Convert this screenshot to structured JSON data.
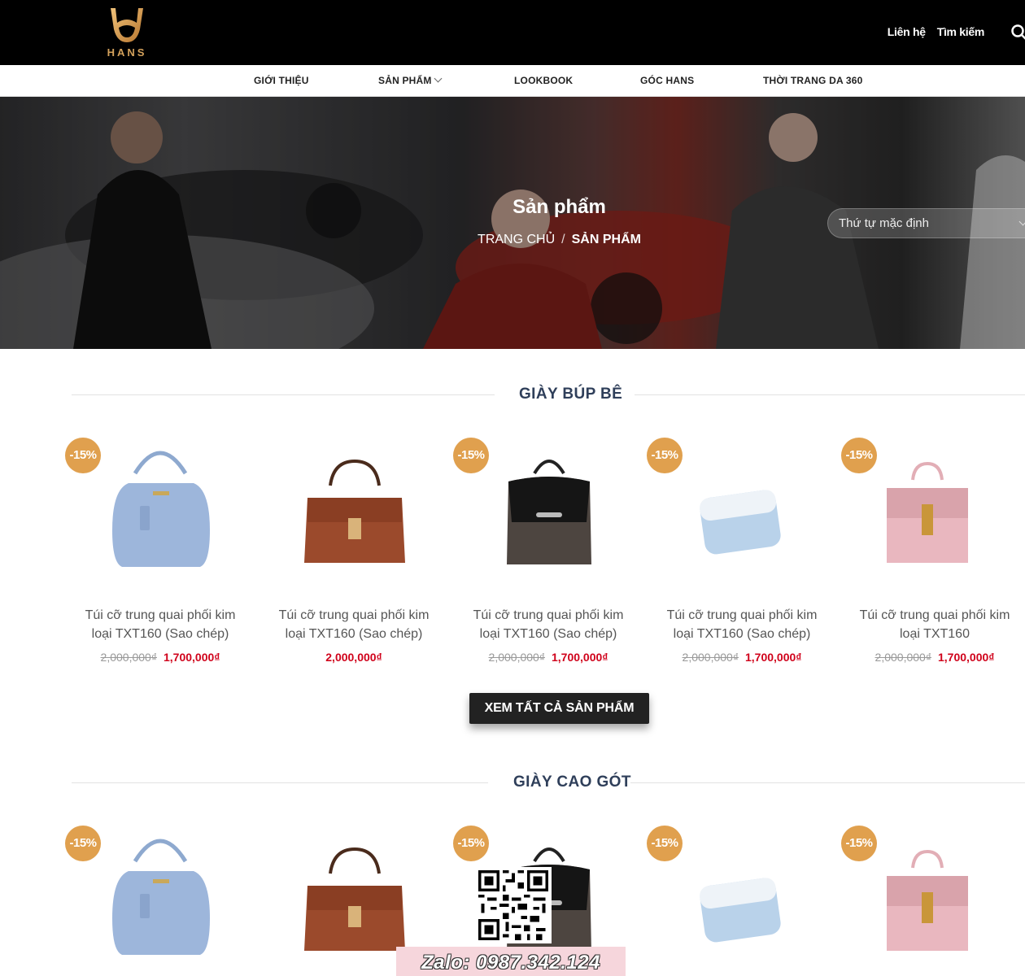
{
  "brand": {
    "logo_text": "HANS",
    "accent": "#d4a25c"
  },
  "topbar": {
    "links": [
      "Liên hệ",
      "Tìm kiếm"
    ],
    "search_icon": "search-icon"
  },
  "nav": {
    "items": [
      "GIỚI THIỆU",
      "SẢN PHẨM",
      "LOOKBOOK",
      "GÓC HANS",
      "THỜI TRANG DA 360"
    ]
  },
  "hero": {
    "title": "Sản phẩm",
    "breadcrumb": {
      "home": "TRANG CHỦ",
      "separator": "/",
      "current": "SẢN PHẨM"
    },
    "sort_select": {
      "value": "Thứ tự mặc định"
    }
  },
  "sections": [
    {
      "title": "GIÀY BÚP BÊ",
      "products": [
        {
          "name_1": "Túi cỡ trung quai phối kim",
          "name_2": "loại TXT160 (Sao chép)",
          "badge": "-15%",
          "old_price": "2,000,000₫",
          "price": "1,700,000₫",
          "image": "blue-handbag"
        },
        {
          "name_1": "Túi cỡ trung quai phối kim",
          "name_2": "loại TXT160 (Sao chép)",
          "badge": "",
          "old_price": "",
          "price": "2,000,000₫",
          "image": "brown-handbag"
        },
        {
          "name_1": "Túi cỡ trung quai phối kim",
          "name_2": "loại TXT160 (Sao chép)",
          "badge": "-15%",
          "old_price": "2,000,000₫",
          "price": "1,700,000₫",
          "image": "black-backpack"
        },
        {
          "name_1": "Túi cỡ trung quai phối kim",
          "name_2": "loại TXT160 (Sao chép)",
          "badge": "-15%",
          "old_price": "2,000,000₫",
          "price": "1,700,000₫",
          "image": "light-blue-wallet"
        },
        {
          "name_1": "Túi cỡ trung quai phối kim",
          "name_2": "loại TXT160",
          "badge": "-15%",
          "old_price": "2,000,000₫",
          "price": "1,700,000₫",
          "image": "pink-handbag"
        }
      ],
      "view_all": "XEM TẤT CẢ SẢN PHẨM"
    },
    {
      "title": "GIÀY CAO GÓT",
      "products": [
        {
          "badge": "-15%",
          "image": "blue-handbag"
        },
        {
          "badge": "",
          "image": "brown-handbag"
        },
        {
          "badge": "-15%",
          "image": "black-backpack"
        },
        {
          "badge": "-15%",
          "image": "light-blue-wallet"
        },
        {
          "badge": "-15%",
          "image": "pink-handbag"
        }
      ]
    }
  ],
  "zalo": {
    "text": "Zalo: 0987.342.124"
  },
  "colors": {
    "badge": "#e0a04e",
    "sale_price": "#d0021b",
    "heading": "#2f3f5a",
    "button": "#222222"
  }
}
